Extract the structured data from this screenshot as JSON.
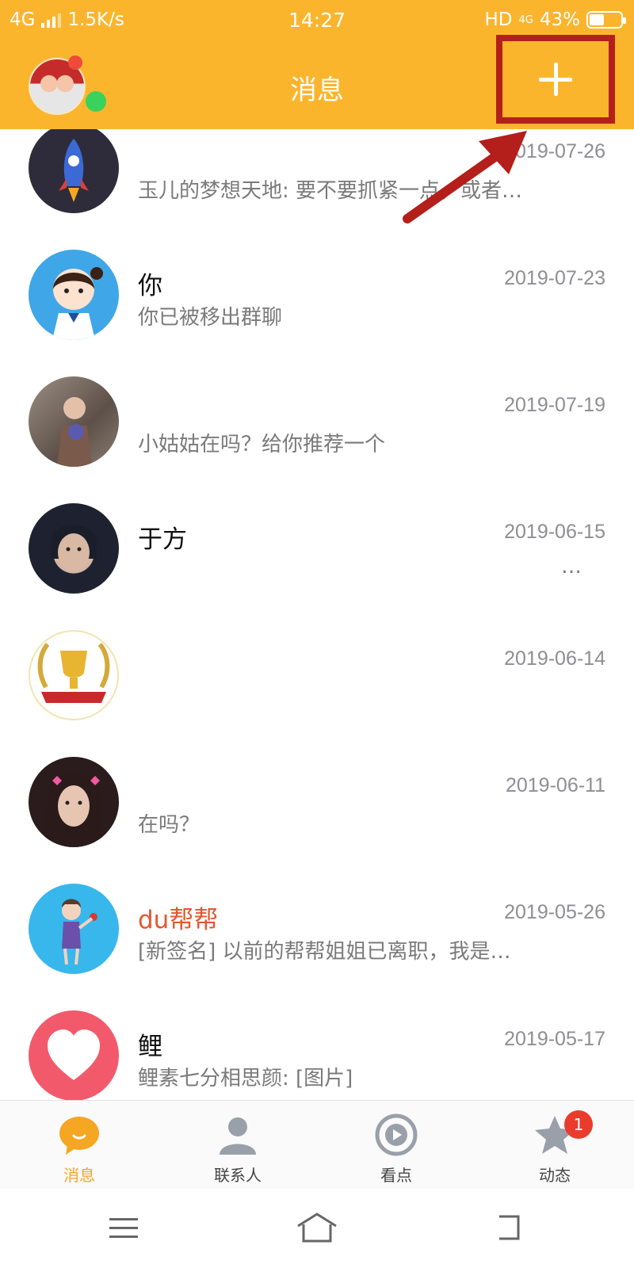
{
  "status": {
    "network": "4G",
    "speed": "1.5K/s",
    "time": "14:27",
    "hd": "HD",
    "net2": "4G",
    "battery": "43%"
  },
  "header": {
    "title": "消息"
  },
  "messages": [
    {
      "name": "",
      "date": "2019-07-26",
      "preview": "玉儿的梦想天地: 要不要抓紧一点，或者…",
      "avatar": "rocket-icon"
    },
    {
      "name": "你",
      "date": "2019-07-23",
      "preview": "你已被移出群聊",
      "avatar": "girl-cartoon-icon"
    },
    {
      "name": "",
      "date": "2019-07-19",
      "preview": "小姑姑在吗？给你推荐一个",
      "avatar": "photo"
    },
    {
      "name": "于方",
      "date": "2019-06-15",
      "preview": "…",
      "avatar": "photo"
    },
    {
      "name": "",
      "date": "2019-06-14",
      "preview": "",
      "avatar": "trophy-icon"
    },
    {
      "name": "",
      "date": "2019-06-11",
      "preview": "在吗？",
      "avatar": "photo"
    },
    {
      "name": "du帮帮",
      "date": "2019-05-26",
      "preview": "[新签名] 以前的帮帮姐姐已离职，我是…",
      "avatar": "cartoon"
    },
    {
      "name": "鲤",
      "date": "2019-05-17",
      "preview": "鲤素七分相思颜: [图片]",
      "avatar": "heart-icon"
    }
  ],
  "tabs": [
    {
      "label": "消息",
      "icon": "chat-bubble-icon",
      "active": true
    },
    {
      "label": "联系人",
      "icon": "contact-icon"
    },
    {
      "label": "看点",
      "icon": "play-icon"
    },
    {
      "label": "动态",
      "icon": "star-icon",
      "badge": "1"
    }
  ],
  "colors": {
    "header": "#fbb52d",
    "accent_red": "#b41f1b",
    "name_orange": "#e4572e",
    "tab_active": "#f5a623"
  }
}
